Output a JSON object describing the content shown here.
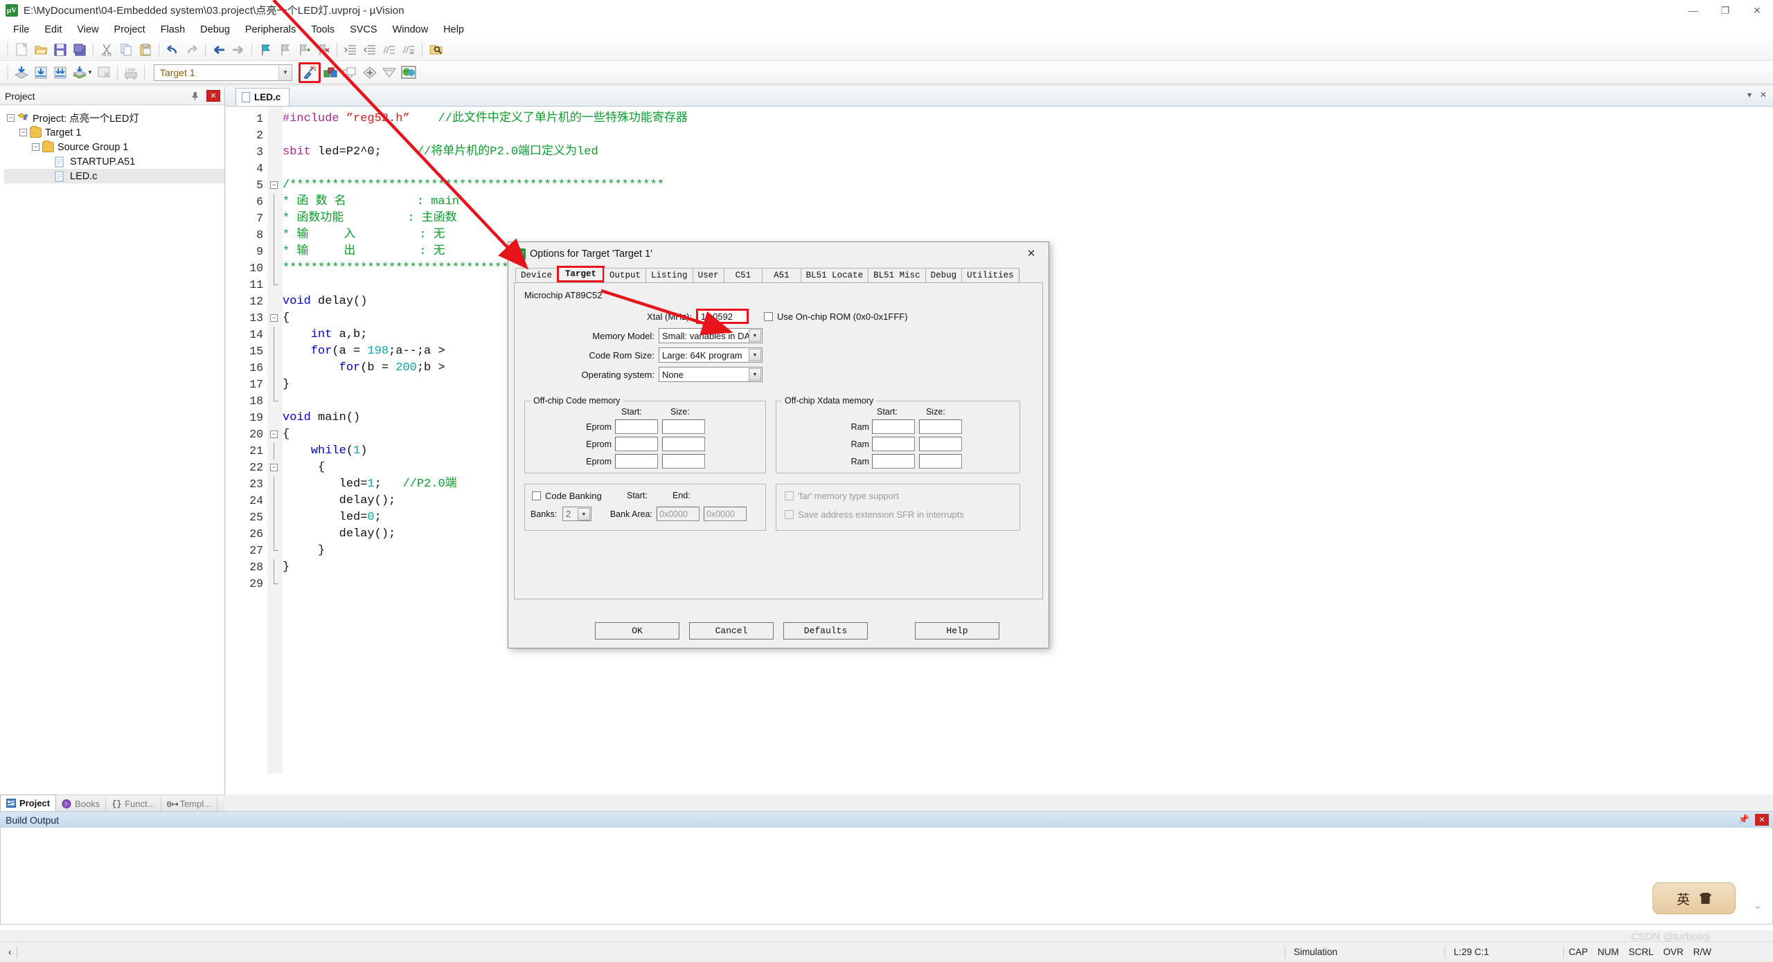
{
  "window": {
    "title": "E:\\MyDocument\\04-Embedded system\\03.project\\点亮一个LED灯.uvproj - µVision",
    "icon": "uvision-icon",
    "minimize": "—",
    "restore": "❐",
    "close": "✕"
  },
  "menu": [
    "File",
    "Edit",
    "View",
    "Project",
    "Flash",
    "Debug",
    "Peripherals",
    "Tools",
    "SVCS",
    "Window",
    "Help"
  ],
  "toolbar1": [
    {
      "name": "new-file-icon",
      "glyph": "🗋"
    },
    {
      "name": "open-file-icon",
      "glyph": "📂"
    },
    {
      "name": "save-icon",
      "glyph": "💾"
    },
    {
      "name": "save-all-icon",
      "glyph": "💾"
    },
    {
      "name": "cut-icon",
      "glyph": "✂"
    },
    {
      "name": "copy-icon",
      "glyph": "⧉"
    },
    {
      "name": "paste-icon",
      "glyph": "📋"
    },
    {
      "name": "undo-icon",
      "glyph": "↶"
    },
    {
      "name": "redo-icon",
      "glyph": "↷"
    },
    {
      "name": "navigate-back-icon",
      "glyph": "←"
    },
    {
      "name": "navigate-forward-icon",
      "glyph": "→"
    },
    {
      "name": "bookmark-toggle-icon",
      "glyph": "⚑"
    },
    {
      "name": "bookmark-prev-icon",
      "glyph": "⚑"
    },
    {
      "name": "bookmark-next-icon",
      "glyph": "⚑"
    },
    {
      "name": "bookmark-clear-icon",
      "glyph": "⚑"
    },
    {
      "name": "indent-icon",
      "glyph": "≡"
    },
    {
      "name": "outdent-icon",
      "glyph": "≡"
    },
    {
      "name": "comment-icon",
      "glyph": "∕"
    },
    {
      "name": "uncomment-icon",
      "glyph": "∕"
    },
    {
      "name": "find-in-files-icon",
      "glyph": "🔍"
    }
  ],
  "toolbar2": {
    "left_buttons": [
      {
        "name": "build-icon",
        "glyph": "⬇"
      },
      {
        "name": "translate-icon",
        "glyph": "⬇"
      },
      {
        "name": "rebuild-all-icon",
        "glyph": "⬇"
      },
      {
        "name": "batch-build-icon",
        "glyph": "⬇"
      },
      {
        "name": "stop-build-icon",
        "glyph": "▦"
      },
      {
        "name": "download-to-flash-icon",
        "glyph": "LOAD"
      }
    ],
    "target_selector": {
      "name": "target-selector",
      "value": "Target 1",
      "arrow": "▼"
    },
    "right_buttons": [
      {
        "name": "options-for-target-icon",
        "glyph": "🪄",
        "highlighted": true
      },
      {
        "name": "manage-project-items-icon",
        "glyph": "■"
      },
      {
        "name": "multi-project-icon",
        "glyph": "❑"
      },
      {
        "name": "configuration-wizard-icon",
        "glyph": "◈"
      },
      {
        "name": "pack-installer-icon",
        "glyph": "▽"
      },
      {
        "name": "manage-run-time-env-icon",
        "glyph": "🌍"
      }
    ]
  },
  "project_pane": {
    "title": "Project",
    "pin_icon": "pin-icon",
    "close_icon": "✕",
    "tree": [
      {
        "label": "Project: 点亮一个LED灯",
        "icon": "project-icon",
        "depth": 0,
        "expander": "-",
        "selected": false
      },
      {
        "label": "Target 1",
        "icon": "target-folder-icon",
        "depth": 1,
        "expander": "-",
        "selected": false
      },
      {
        "label": "Source Group 1",
        "icon": "folder-icon",
        "depth": 2,
        "expander": "-",
        "selected": false
      },
      {
        "label": "STARTUP.A51",
        "icon": "file-icon",
        "depth": 3,
        "expander": "",
        "selected": false
      },
      {
        "label": "LED.c",
        "icon": "file-icon",
        "depth": 3,
        "expander": "",
        "selected": true
      }
    ],
    "tabs": [
      {
        "label": "Project",
        "icon": "project-tab-icon",
        "active": true
      },
      {
        "label": "Books",
        "icon": "books-tab-icon",
        "active": false
      },
      {
        "label": "Funct...",
        "icon": "functions-tab-icon",
        "active": false
      },
      {
        "label": "Templ...",
        "icon": "templates-tab-icon",
        "active": false
      }
    ]
  },
  "editor": {
    "tab": {
      "label": "LED.c",
      "icon": "c-file-icon"
    },
    "lines": [
      {
        "n": 1,
        "fold": "",
        "segs": [
          {
            "t": "#include ",
            "c": "kw"
          },
          {
            "t": "”reg52.h”",
            "c": "st"
          },
          {
            "t": "    ",
            "c": "tx"
          },
          {
            "t": "//此文件中定义了单片机的一些特殊功能寄存器",
            "c": "cm"
          }
        ]
      },
      {
        "n": 2,
        "fold": "",
        "segs": []
      },
      {
        "n": 3,
        "fold": "",
        "segs": [
          {
            "t": "sbit",
            "c": "kw"
          },
          {
            "t": " led=P2^0;     ",
            "c": "tx"
          },
          {
            "t": "//将单片机的P2.0端口定义为led",
            "c": "cm"
          }
        ]
      },
      {
        "n": 4,
        "fold": "",
        "segs": []
      },
      {
        "n": 5,
        "fold": "box-",
        "segs": [
          {
            "t": "/*****************************************************",
            "c": "cm"
          }
        ]
      },
      {
        "n": 6,
        "fold": "line",
        "segs": [
          {
            "t": "* 函 数 名          : main",
            "c": "cm"
          }
        ]
      },
      {
        "n": 7,
        "fold": "line",
        "segs": [
          {
            "t": "* 函数功能         : 主函数",
            "c": "cm"
          }
        ]
      },
      {
        "n": 8,
        "fold": "line",
        "segs": [
          {
            "t": "* 输     入         : 无",
            "c": "cm"
          }
        ]
      },
      {
        "n": 9,
        "fold": "line",
        "segs": [
          {
            "t": "* 输     出         : 无",
            "c": "cm"
          }
        ]
      },
      {
        "n": 10,
        "fold": "line",
        "segs": [
          {
            "t": "*****************************************************",
            "c": "cm"
          }
        ]
      },
      {
        "n": 11,
        "fold": "end",
        "segs": []
      },
      {
        "n": 12,
        "fold": "",
        "segs": [
          {
            "t": "void",
            "c": "k"
          },
          {
            "t": " delay()",
            "c": "tx"
          }
        ]
      },
      {
        "n": 13,
        "fold": "box-",
        "segs": [
          {
            "t": "{",
            "c": "tx"
          }
        ]
      },
      {
        "n": 14,
        "fold": "line",
        "segs": [
          {
            "t": "    ",
            "c": "tx"
          },
          {
            "t": "int",
            "c": "k"
          },
          {
            "t": " a,b;",
            "c": "tx"
          }
        ]
      },
      {
        "n": 15,
        "fold": "line",
        "segs": [
          {
            "t": "    ",
            "c": "tx"
          },
          {
            "t": "for",
            "c": "k"
          },
          {
            "t": "(a = ",
            "c": "tx"
          },
          {
            "t": "198",
            "c": "nm"
          },
          {
            "t": ";a--;a >",
            "c": "tx"
          }
        ]
      },
      {
        "n": 16,
        "fold": "line",
        "segs": [
          {
            "t": "        ",
            "c": "tx"
          },
          {
            "t": "for",
            "c": "k"
          },
          {
            "t": "(b = ",
            "c": "tx"
          },
          {
            "t": "200",
            "c": "nm"
          },
          {
            "t": ";b >",
            "c": "tx"
          }
        ]
      },
      {
        "n": 17,
        "fold": "line",
        "segs": [
          {
            "t": "}",
            "c": "tx"
          }
        ]
      },
      {
        "n": 18,
        "fold": "end",
        "segs": []
      },
      {
        "n": 19,
        "fold": "",
        "segs": [
          {
            "t": "void",
            "c": "k"
          },
          {
            "t": " main()",
            "c": "tx"
          }
        ]
      },
      {
        "n": 20,
        "fold": "box-",
        "segs": [
          {
            "t": "{",
            "c": "tx"
          }
        ]
      },
      {
        "n": 21,
        "fold": "line",
        "segs": [
          {
            "t": "    ",
            "c": "tx"
          },
          {
            "t": "while",
            "c": "k"
          },
          {
            "t": "(",
            "c": "tx"
          },
          {
            "t": "1",
            "c": "nm"
          },
          {
            "t": ")",
            "c": "tx"
          }
        ]
      },
      {
        "n": 22,
        "fold": "box2-",
        "segs": [
          {
            "t": "     {",
            "c": "tx"
          }
        ]
      },
      {
        "n": 23,
        "fold": "line2",
        "segs": [
          {
            "t": "        led=",
            "c": "tx"
          },
          {
            "t": "1",
            "c": "nm"
          },
          {
            "t": ";   ",
            "c": "tx"
          },
          {
            "t": "//P2.0端",
            "c": "cm"
          }
        ]
      },
      {
        "n": 24,
        "fold": "line2",
        "segs": [
          {
            "t": "        delay();",
            "c": "tx"
          }
        ]
      },
      {
        "n": 25,
        "fold": "line2",
        "segs": [
          {
            "t": "        led=",
            "c": "tx"
          },
          {
            "t": "0",
            "c": "nm"
          },
          {
            "t": ";",
            "c": "tx"
          }
        ]
      },
      {
        "n": 26,
        "fold": "line2",
        "segs": [
          {
            "t": "        delay();",
            "c": "tx"
          }
        ]
      },
      {
        "n": 27,
        "fold": "end2",
        "segs": [
          {
            "t": "     }",
            "c": "tx"
          }
        ]
      },
      {
        "n": 28,
        "fold": "line",
        "segs": [
          {
            "t": "}",
            "c": "tx"
          }
        ]
      },
      {
        "n": 29,
        "fold": "end",
        "segs": []
      }
    ]
  },
  "dialog": {
    "title": "Options for Target 'Target 1'",
    "icon": "uvision-icon",
    "close": "✕",
    "tabs": [
      {
        "label": "Device",
        "active": false
      },
      {
        "label": "Target",
        "active": true,
        "highlighted": true
      },
      {
        "label": "Output",
        "active": false
      },
      {
        "label": "Listing",
        "active": false
      },
      {
        "label": "User",
        "active": false
      },
      {
        "label": "C51",
        "active": false
      },
      {
        "label": "A51",
        "active": false
      },
      {
        "label": "BL51 Locate",
        "active": false
      },
      {
        "label": "BL51 Misc",
        "active": false
      },
      {
        "label": "Debug",
        "active": false
      },
      {
        "label": "Utilities",
        "active": false
      }
    ],
    "device_name": "Microchip AT89C52",
    "xtal": {
      "label": "Xtal (MHz):",
      "value": "11.0592",
      "highlighted": true
    },
    "on_chip_rom": {
      "label": "Use On-chip ROM (0x0-0x1FFF)",
      "checked": false
    },
    "memory_model": {
      "label": "Memory Model:",
      "value": "Small: variables in DATA"
    },
    "code_rom_size": {
      "label": "Code Rom Size:",
      "value": "Large: 64K program"
    },
    "operating_system": {
      "label": "Operating system:",
      "value": "None"
    },
    "offchip_code": {
      "title": "Off-chip Code memory",
      "col_start": "Start:",
      "col_size": "Size:",
      "rows": [
        {
          "label": "Eprom",
          "start": "",
          "size": ""
        },
        {
          "label": "Eprom",
          "start": "",
          "size": ""
        },
        {
          "label": "Eprom",
          "start": "",
          "size": ""
        }
      ]
    },
    "offchip_xdata": {
      "title": "Off-chip Xdata memory",
      "col_start": "Start:",
      "col_size": "Size:",
      "rows": [
        {
          "label": "Ram",
          "start": "",
          "size": ""
        },
        {
          "label": "Ram",
          "start": "",
          "size": ""
        },
        {
          "label": "Ram",
          "start": "",
          "size": ""
        }
      ]
    },
    "code_banking": {
      "checkbox_label": "Code Banking",
      "checked": false,
      "banks_label": "Banks:",
      "banks_value": "2",
      "start_label": "Start:",
      "end_label": "End:",
      "bank_area_label": "Bank Area:",
      "bank_start": "0x0000",
      "bank_end": "0x0000"
    },
    "far_options": [
      {
        "label": "'far' memory type support",
        "checked": false,
        "disabled": true
      },
      {
        "label": "Save address extension SFR in interrupts",
        "checked": false,
        "disabled": true
      }
    ],
    "buttons": [
      {
        "label": "OK",
        "name": "ok-button"
      },
      {
        "label": "Cancel",
        "name": "cancel-button"
      },
      {
        "label": "Defaults",
        "name": "defaults-button"
      },
      {
        "label": "Help",
        "name": "help-button"
      }
    ]
  },
  "build_output": {
    "title": "Build Output",
    "pin_icon": "pin-icon",
    "close_icon": "✕",
    "content": ""
  },
  "statusbar": {
    "simulation": "Simulation",
    "cursor": "L:29 C:1",
    "indicators": [
      "CAP",
      "NUM",
      "SCRL",
      "OVR",
      "R/W"
    ]
  },
  "ime": {
    "mode": "英",
    "icon": "shirt-icon"
  },
  "watermark": "CSDN @turbosqi",
  "colors": {
    "accent_red": "#e8141c",
    "title_bar": "#ffffff",
    "dialog_bg": "#f0f0f0",
    "comment_green": "#0f9b2e",
    "keyword_blue": "#0000c8",
    "preproc_purple": "#a52a8c",
    "string_red": "#cc2222",
    "number_teal": "#0aa5a5",
    "target_text": "#8b5a10"
  }
}
